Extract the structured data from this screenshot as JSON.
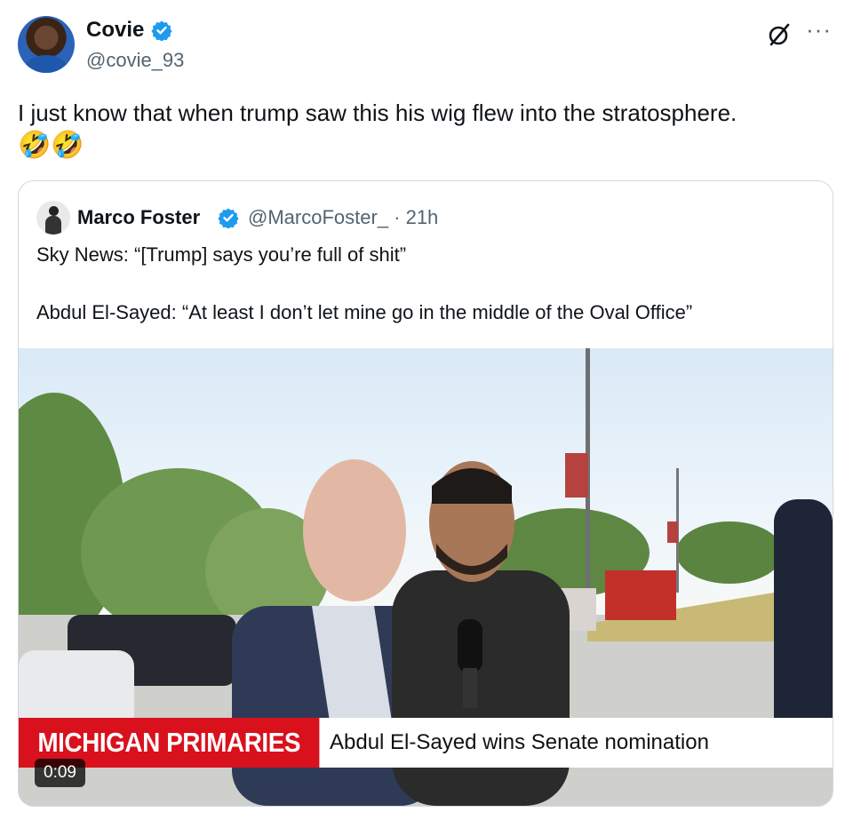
{
  "author": {
    "name": "Covie",
    "handle": "@covie_93"
  },
  "tweet": {
    "text": "I just know that when trump saw this his wig flew into the stratosphere.",
    "emoji": "🤣🤣"
  },
  "quoted": {
    "name": "Marco Foster",
    "handle_time": "@MarcoFoster_ · 21h",
    "line1": "Sky News: “[Trump] says you’re full of shit”",
    "line2": "Abdul El-Sayed: “At least I don’t let mine go in the middle of the Oval Office”"
  },
  "media": {
    "banner_red": "MICHIGAN PRIMARIES",
    "banner_text": "Abdul El-Sayed wins Senate nomination",
    "duration": "0:09"
  },
  "colors": {
    "verified": "#1d9bf0",
    "banner_red": "#d8111d",
    "secondary_text": "#536471"
  },
  "icons": {
    "verified": "verified-badge-icon",
    "grok": "grok-icon",
    "more": "more-icon"
  }
}
